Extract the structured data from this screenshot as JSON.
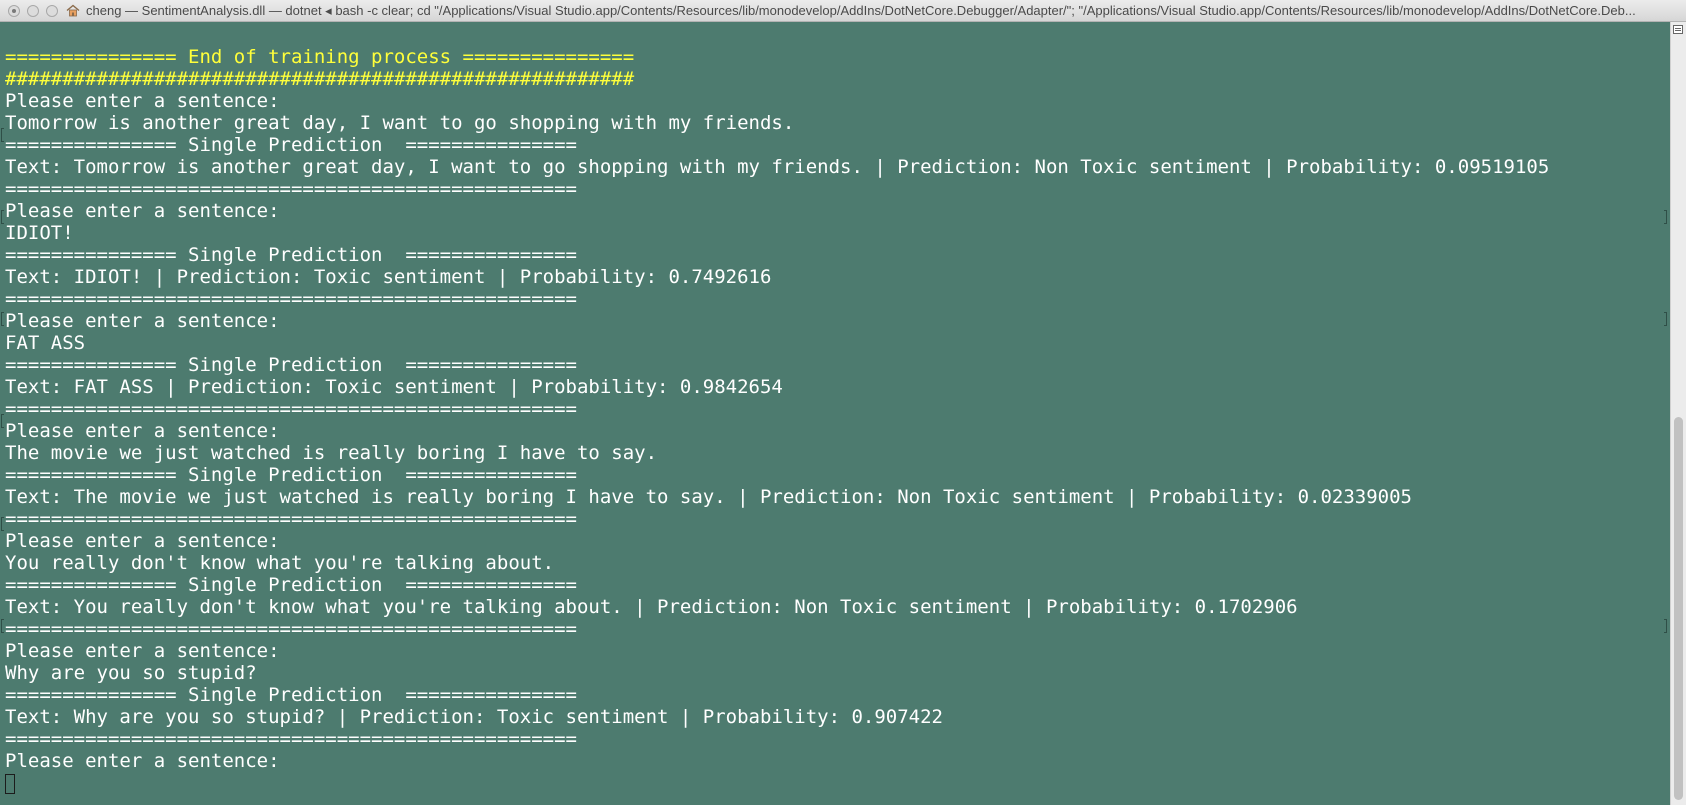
{
  "window": {
    "title": "cheng — SentimentAnalysis.dll — dotnet ◂ bash -c clear; cd \"/Applications/Visual Studio.app/Contents/Resources/lib/monodevelop/AddIns/DotNetCore.Debugger/Adapter/\"; \"/Applications/Visual Studio.app/Contents/Resources/lib/monodevelop/AddIns/DotNetCore.Deb..."
  },
  "terminal": {
    "lines": [
      {
        "text": "=============== End of training process ===============",
        "color": "yellow"
      },
      {
        "text": "#######################################################",
        "color": "yellow"
      },
      {
        "text": "Please enter a sentence:",
        "color": "white"
      },
      {
        "text": "Tomorrow is another great day, I want to go shopping with my friends.",
        "color": "white"
      },
      {
        "text": "=============== Single Prediction  ===============",
        "color": "white"
      },
      {
        "text": "Text: Tomorrow is another great day, I want to go shopping with my friends. | Prediction: Non Toxic sentiment | Probability: 0.09519105",
        "color": "white"
      },
      {
        "text": "==================================================",
        "color": "white"
      },
      {
        "text": "Please enter a sentence:",
        "color": "white"
      },
      {
        "text": "IDIOT!",
        "color": "white"
      },
      {
        "text": "=============== Single Prediction  ===============",
        "color": "white"
      },
      {
        "text": "Text: IDIOT! | Prediction: Toxic sentiment | Probability: 0.7492616",
        "color": "white"
      },
      {
        "text": "==================================================",
        "color": "white"
      },
      {
        "text": "Please enter a sentence:",
        "color": "white"
      },
      {
        "text": "FAT ASS",
        "color": "white"
      },
      {
        "text": "=============== Single Prediction  ===============",
        "color": "white"
      },
      {
        "text": "Text: FAT ASS | Prediction: Toxic sentiment | Probability: 0.9842654",
        "color": "white"
      },
      {
        "text": "==================================================",
        "color": "white"
      },
      {
        "text": "Please enter a sentence:",
        "color": "white"
      },
      {
        "text": "The movie we just watched is really boring I have to say.",
        "color": "white"
      },
      {
        "text": "=============== Single Prediction  ===============",
        "color": "white"
      },
      {
        "text": "Text: The movie we just watched is really boring I have to say. | Prediction: Non Toxic sentiment | Probability: 0.02339005",
        "color": "white"
      },
      {
        "text": "==================================================",
        "color": "white"
      },
      {
        "text": "Please enter a sentence:",
        "color": "white"
      },
      {
        "text": "You really don't know what you're talking about.",
        "color": "white"
      },
      {
        "text": "=============== Single Prediction  ===============",
        "color": "white"
      },
      {
        "text": "Text: You really don't know what you're talking about. | Prediction: Non Toxic sentiment | Probability: 0.1702906",
        "color": "white"
      },
      {
        "text": "==================================================",
        "color": "white"
      },
      {
        "text": "Please enter a sentence:",
        "color": "white"
      },
      {
        "text": "Why are you so stupid?",
        "color": "white"
      },
      {
        "text": "=============== Single Prediction  ===============",
        "color": "white"
      },
      {
        "text": "Text: Why are you so stupid? | Prediction: Toxic sentiment | Probability: 0.907422",
        "color": "white"
      },
      {
        "text": "==================================================",
        "color": "white"
      },
      {
        "text": "Please enter a sentence:",
        "color": "white"
      }
    ]
  },
  "colors": {
    "background": "#4d7b6f",
    "text": "#ffffff",
    "highlight": "#ffff3a"
  },
  "icons": {
    "close": "close-dot-icon",
    "minimize": "minimize-dot-icon",
    "zoom": "zoom-dot-icon",
    "home": "home-icon",
    "scroll_menu": "list-icon"
  }
}
